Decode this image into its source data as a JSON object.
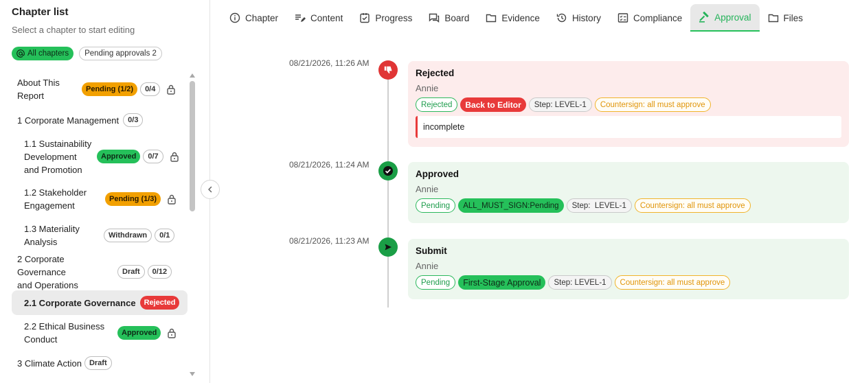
{
  "sidebar": {
    "title": "Chapter list",
    "subtitle": "Select a chapter to start editing",
    "filters": {
      "all": {
        "icon": "at-sign-icon",
        "label": "All chapters"
      },
      "pending": {
        "label": "Pending approvals 2"
      }
    },
    "chapters": [
      {
        "label": "About This Report",
        "lines": [
          "About This",
          "Report"
        ],
        "status": "Pending (1/2)",
        "status_type": "pending",
        "count": "0/4",
        "locked": true
      },
      {
        "label": "1 Corporate Management",
        "status": "",
        "count": "0/3",
        "locked": false
      },
      {
        "label": "1.1 Sustainability Development and Promotion",
        "lines": [
          "1.1 Sustainability",
          "Development",
          "and Promotion"
        ],
        "status": "Approved",
        "status_type": "approved",
        "count": "0/7",
        "locked": true
      },
      {
        "label": "1.2 Stakeholder Engagement",
        "lines": [
          "1.2 Stakeholder",
          "Engagement"
        ],
        "status": "Pending (1/3)",
        "status_type": "pending",
        "count": "",
        "locked": true
      },
      {
        "label": "1.3 Materiality Analysis",
        "lines": [
          "1.3 Materiality",
          "Analysis"
        ],
        "status": "Withdrawn",
        "status_type": "outline",
        "count": "0/1",
        "locked": false
      },
      {
        "label": "2 Corporate Governance and Operations",
        "lines": [
          "2 Corporate Governance",
          "and Operations"
        ],
        "status": "Draft",
        "status_type": "outline",
        "count": "0/12",
        "locked": false
      },
      {
        "label": "2.1 Corporate Governance",
        "status": "Rejected",
        "status_type": "rejected",
        "count": "",
        "locked": false,
        "active": true
      },
      {
        "label": "2.2 Ethical Business Conduct",
        "lines": [
          "2.2 Ethical Business",
          "Conduct"
        ],
        "status": "Approved",
        "status_type": "approved",
        "count": "",
        "locked": true
      },
      {
        "label": "3 Climate Action",
        "status": "Draft",
        "status_type": "outline",
        "count": "",
        "locked": false
      }
    ]
  },
  "tabs": [
    {
      "label": "Chapter",
      "icon": "info-icon"
    },
    {
      "label": "Content",
      "icon": "edit-lines-icon"
    },
    {
      "label": "Progress",
      "icon": "checkbox-icon"
    },
    {
      "label": "Board",
      "icon": "chat-board-icon"
    },
    {
      "label": "Evidence",
      "icon": "folder-icon"
    },
    {
      "label": "History",
      "icon": "history-icon"
    },
    {
      "label": "Compliance",
      "icon": "checklist-icon"
    },
    {
      "label": "Approval",
      "icon": "gavel-icon",
      "active": true
    },
    {
      "label": "Files",
      "icon": "folder-icon"
    }
  ],
  "timeline": [
    {
      "time": "08/21/2026, 11:26 AM",
      "type": "rejected",
      "icon": "thumbs-down-icon",
      "title": "Rejected",
      "user": "Annie",
      "chips": [
        {
          "text": "Rejected",
          "style": "g-out"
        },
        {
          "text": "Back to Editor",
          "style": "r-fill"
        },
        {
          "text": "Step: LEVEL-1",
          "style": "grey"
        },
        {
          "text": "Countersign: all must approve",
          "style": "amber"
        }
      ],
      "comment": "incomplete"
    },
    {
      "time": "08/21/2026, 11:24 AM",
      "type": "approved",
      "icon": "check-circle-icon",
      "title": "Approved",
      "user": "Annie",
      "chips": [
        {
          "text": "Pending",
          "style": "g-out"
        },
        {
          "text": "ALL_MUST_SIGN:Pending",
          "style": "g-fill"
        },
        {
          "text": "Step:  LEVEL-1",
          "style": "grey"
        },
        {
          "text": "Countersign: all must approve",
          "style": "amber"
        }
      ]
    },
    {
      "time": "08/21/2026, 11:23 AM",
      "type": "submit",
      "icon": "send-icon",
      "title": "Submit",
      "user": "Annie",
      "chips": [
        {
          "text": "Pending",
          "style": "g-out"
        },
        {
          "text": "First-Stage Approval",
          "style": "g-fill"
        },
        {
          "text": "Step: LEVEL-1",
          "style": "grey"
        },
        {
          "text": "Countersign: all must approve",
          "style": "amber"
        }
      ]
    }
  ],
  "colors": {
    "accent": "#25c05a",
    "reject": "#e83a3a",
    "pending": "#f2a000"
  }
}
